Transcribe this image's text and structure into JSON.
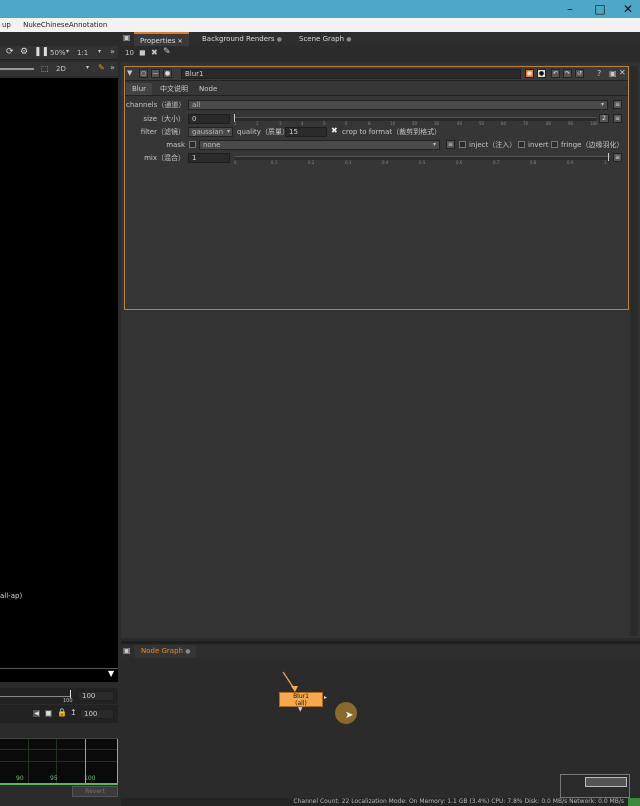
{
  "menubar": {
    "items": [
      "up",
      "NukeChineseAnnotation"
    ]
  },
  "viewer": {
    "zoom": "50%",
    "ratio": "1:1",
    "mode": "2D",
    "overlay_text": "all-ap)",
    "frame_end": "100",
    "frame_field_a": "100",
    "frame_field_b": "100",
    "graph_ticks": [
      "90",
      "95",
      "100"
    ],
    "revert_label": "Revert"
  },
  "tabs": [
    {
      "label": "Properties"
    },
    {
      "label": "Background Renders"
    },
    {
      "label": "Scene Graph"
    }
  ],
  "toolbar": {
    "count": "10"
  },
  "properties": {
    "node_name": "Blur1",
    "subtabs": [
      "Blur",
      "中文说明",
      "Node"
    ],
    "channels_label": "channels（通道）",
    "channels_value": "all",
    "size_label": "size（大小）",
    "size_value": "0",
    "size_ticks": [
      "1",
      "2",
      "3",
      "4",
      "5",
      "6",
      "8",
      "10",
      "20",
      "30",
      "40",
      "50",
      "60",
      "70",
      "80",
      "90",
      "100"
    ],
    "size_count": "2",
    "filter_label": "filter（滤镜）",
    "filter_value": "gaussian",
    "quality_label": "quality（质量）",
    "quality_value": "15",
    "crop_label": "crop to format（裁剪到格式）",
    "mask_label": "mask",
    "mask_value": "none",
    "inject_label": "inject（注入）",
    "invert_label": "invert",
    "fringe_label": "fringe（边缘羽化）",
    "mix_label": "mix（混合）",
    "mix_value": "1",
    "mix_ticks": [
      "0",
      "0.1",
      "0.2",
      "0.3",
      "0.4",
      "0.5",
      "0.6",
      "0.7",
      "0.8",
      "0.9",
      "1"
    ]
  },
  "node_graph": {
    "tab_label": "Node Graph",
    "node_label": "Blur1",
    "node_sub": "(all)"
  },
  "statusbar": {
    "text": "Channel Count: 22  Localization Mode: On  Memory: 1.1 GB (3.4%)  CPU: 7.8%  Disk: 0.0 MB/s  Network: 0.0 MB/s"
  },
  "colors": {
    "accent": "#4fa7c8",
    "node": "#f4a94e",
    "panel_border": "#b8844a",
    "tab_active": "#e07a2a"
  }
}
